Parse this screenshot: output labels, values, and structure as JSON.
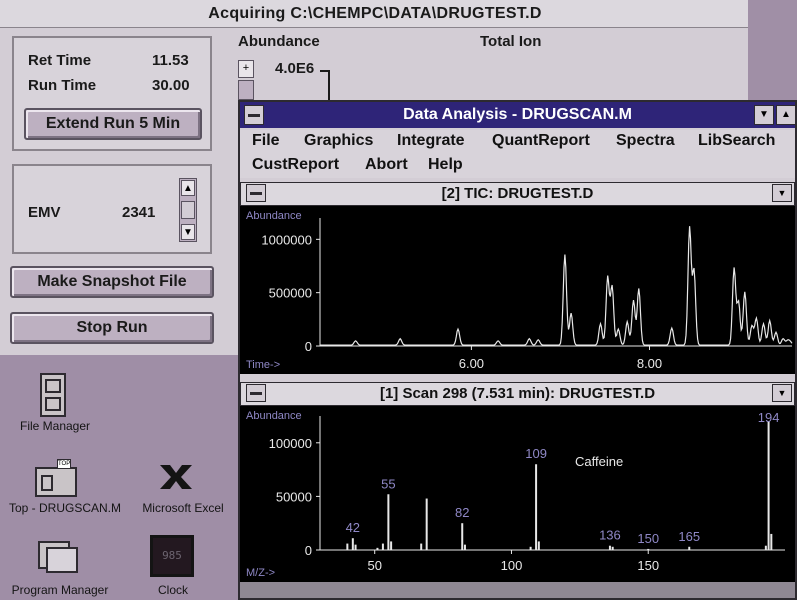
{
  "acq": {
    "title": "Acquiring C:\\CHEMPC\\DATA\\DRUGTEST.D",
    "ret_time_label": "Ret Time",
    "ret_time_value": "11.53",
    "run_time_label": "Run Time",
    "run_time_value": "30.00",
    "extend_button": "Extend Run 5 Min",
    "emv_label": "EMV",
    "emv_value": "2341",
    "snapshot_button": "Make Snapshot File",
    "stop_button": "Stop Run",
    "abundance_label": "Abundance",
    "total_ion_label": "Total Ion",
    "scale_value": "4.0E6"
  },
  "desktop": {
    "icons": [
      {
        "label": "File Manager",
        "icon": "file-cabinet-icon"
      },
      {
        "label": "Top - DRUGSCAN.M",
        "icon": "gc-instrument-icon"
      },
      {
        "label": "Microsoft Excel",
        "icon": "excel-icon"
      },
      {
        "label": "Program Manager",
        "icon": "program-manager-icon"
      },
      {
        "label": "Clock",
        "icon": "clock-icon",
        "display": "985"
      }
    ]
  },
  "analysis": {
    "title": "Data Analysis - DRUGSCAN.M",
    "menu": [
      "File",
      "Graphics",
      "Integrate",
      "QuantReport",
      "Spectra",
      "LibSearch",
      "CustReport",
      "Abort",
      "Help"
    ],
    "tic": {
      "title": "[2] TIC: DRUGTEST.D",
      "ylabel": "Abundance",
      "xlabel": "Time->",
      "yticks": [
        "1000000",
        "500000",
        "0"
      ],
      "xticks": [
        "6.00",
        "8.00"
      ]
    },
    "scan": {
      "title": "[1] Scan 298 (7.531 min): DRUGTEST.D",
      "ylabel": "Abundance",
      "xlabel": "M/Z->",
      "yticks": [
        "100000",
        "50000",
        "0"
      ],
      "xticks": [
        "50",
        "100",
        "150"
      ],
      "annotation": "Caffeine",
      "peak_labels": [
        "42",
        "55",
        "82",
        "109",
        "136",
        "150",
        "165",
        "194"
      ]
    }
  },
  "chart_data": [
    {
      "type": "line",
      "title": "[2] TIC: DRUGTEST.D",
      "xlabel": "Time->",
      "ylabel": "Abundance",
      "xlim": [
        4.3,
        9.6
      ],
      "ylim": [
        0,
        1200000
      ],
      "peaks": [
        {
          "x": 4.7,
          "y": 40000
        },
        {
          "x": 5.2,
          "y": 60000
        },
        {
          "x": 5.85,
          "y": 150000
        },
        {
          "x": 6.3,
          "y": 40000
        },
        {
          "x": 6.65,
          "y": 60000
        },
        {
          "x": 6.75,
          "y": 50000
        },
        {
          "x": 7.05,
          "y": 850000
        },
        {
          "x": 7.12,
          "y": 300000
        },
        {
          "x": 7.45,
          "y": 200000
        },
        {
          "x": 7.53,
          "y": 640000
        },
        {
          "x": 7.58,
          "y": 550000
        },
        {
          "x": 7.65,
          "y": 150000
        },
        {
          "x": 7.75,
          "y": 220000
        },
        {
          "x": 7.82,
          "y": 420000
        },
        {
          "x": 7.88,
          "y": 530000
        },
        {
          "x": 8.25,
          "y": 160000
        },
        {
          "x": 8.45,
          "y": 1100000
        },
        {
          "x": 8.5,
          "y": 700000
        },
        {
          "x": 8.95,
          "y": 720000
        },
        {
          "x": 9.0,
          "y": 400000
        },
        {
          "x": 9.07,
          "y": 500000
        },
        {
          "x": 9.15,
          "y": 180000
        },
        {
          "x": 9.2,
          "y": 250000
        },
        {
          "x": 9.28,
          "y": 200000
        },
        {
          "x": 9.35,
          "y": 230000
        },
        {
          "x": 9.42,
          "y": 120000
        },
        {
          "x": 9.5,
          "y": 60000
        },
        {
          "x": 9.55,
          "y": 40000
        },
        {
          "x": 9.58,
          "y": 30000
        }
      ]
    },
    {
      "type": "bar",
      "title": "[1] Scan 298 (7.531 min): DRUGTEST.D",
      "xlabel": "M/Z->",
      "ylabel": "Abundance",
      "xlim": [
        30,
        200
      ],
      "ylim": [
        0,
        125000
      ],
      "x": [
        40,
        42,
        43,
        51,
        53,
        55,
        56,
        67,
        69,
        82,
        83,
        107,
        109,
        110,
        136,
        137,
        150,
        165,
        193,
        194,
        195
      ],
      "values": [
        6000,
        11000,
        5000,
        2000,
        6000,
        52000,
        8000,
        6000,
        48000,
        25000,
        5000,
        3000,
        80000,
        8000,
        4000,
        3000,
        1000,
        3000,
        4000,
        120000,
        15000
      ]
    }
  ]
}
